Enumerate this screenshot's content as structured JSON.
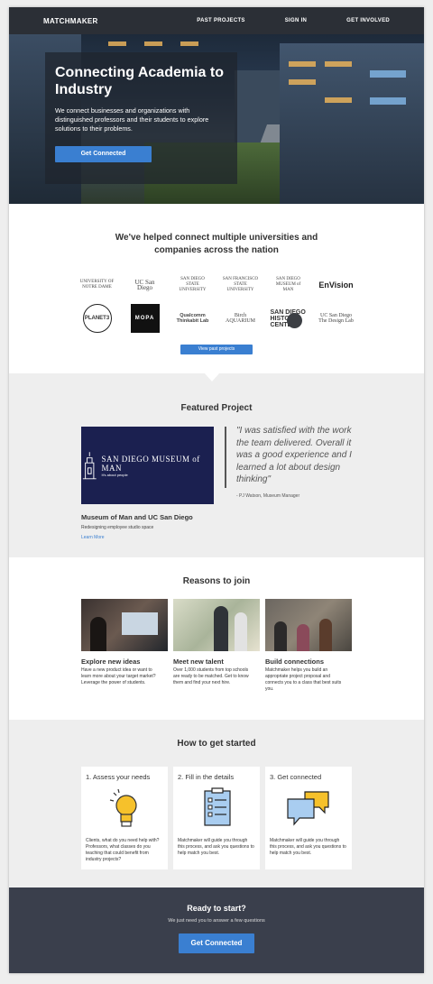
{
  "nav": {
    "brand": "MATCHMAKER",
    "links": [
      "PAST PROJECTS",
      "SIGN IN",
      "GET INVOLVED"
    ]
  },
  "hero": {
    "title": "Connecting Academia to Industry",
    "subtitle": "We connect businesses and organizations with distinguished professors and their students to explore solutions to their problems.",
    "button": "Get Connected",
    "slides": 3,
    "active_slide": 1
  },
  "partners": {
    "title": "We've helped connect multiple universities and companies across the nation",
    "row1": [
      "UNIVERSITY OF NOTRE DAME",
      "UC San Diego",
      "SAN DIEGO STATE UNIVERSITY",
      "SAN FRANCISCO STATE UNIVERSITY",
      "SAN DIEGO MUSEUM of MAN",
      "EnVision"
    ],
    "row2": {
      "planet": "PLANET3",
      "mopa": "MOPA",
      "qualcomm": "Qualcomm Thinkabit Lab",
      "aquarium": "Birch AQUARIUM",
      "history": "SAN DIEGO HISTORY CENTER",
      "ucsd_design": "UC San Diego The Design Lab"
    },
    "button": "View past projects"
  },
  "featured": {
    "title": "Featured Project",
    "image_title": "SAN DIEGO MUSEUM of MAN",
    "image_tagline": "It's about people",
    "name": "Museum of Man and UC San Diego",
    "desc": "Redesigning employee studio space",
    "link": "Learn More",
    "quote": "\"I was satisfied with the work the team delivered. Overall it was a good experience and I learned a lot about design thinking\"",
    "author": "- PJ Watson, Museum Manager"
  },
  "reasons": {
    "title": "Reasons to join",
    "items": [
      {
        "title": "Explore new ideas",
        "text": "Have a new product idea or want to learn more about your target market? Leverage the power of students."
      },
      {
        "title": "Meet new talent",
        "text": "Over 1,000 students from top schools are ready to be matched. Get to know them and find your next hire."
      },
      {
        "title": "Build connections",
        "text": "Matchmaker helps you build an appropriate project proposal and connects you to a class that best suits you."
      }
    ]
  },
  "how": {
    "title": "How to get started",
    "steps": [
      {
        "title": "1. Assess your needs",
        "text": "Clients, what do you need help with? Professors, what classes do you teaching that could benefit from industry projects?",
        "icon": "lightbulb-icon"
      },
      {
        "title": "2. Fill in the details",
        "text": "Matchmaker will guide you through this process, and ask you questions to help match you best.",
        "icon": "checklist-icon"
      },
      {
        "title": "3. Get connected",
        "text": "Matchmaker will guide you through this process, and ask you questions to help match you best.",
        "icon": "chat-bubbles-icon"
      }
    ]
  },
  "cta": {
    "title": "Ready to start?",
    "subtitle": "We just need you to answer a few questions",
    "button": "Get Connected"
  },
  "colors": {
    "accent": "#3a7fd1",
    "nav_bg": "#2b2f36",
    "cta_bg": "#3a3f4c"
  }
}
